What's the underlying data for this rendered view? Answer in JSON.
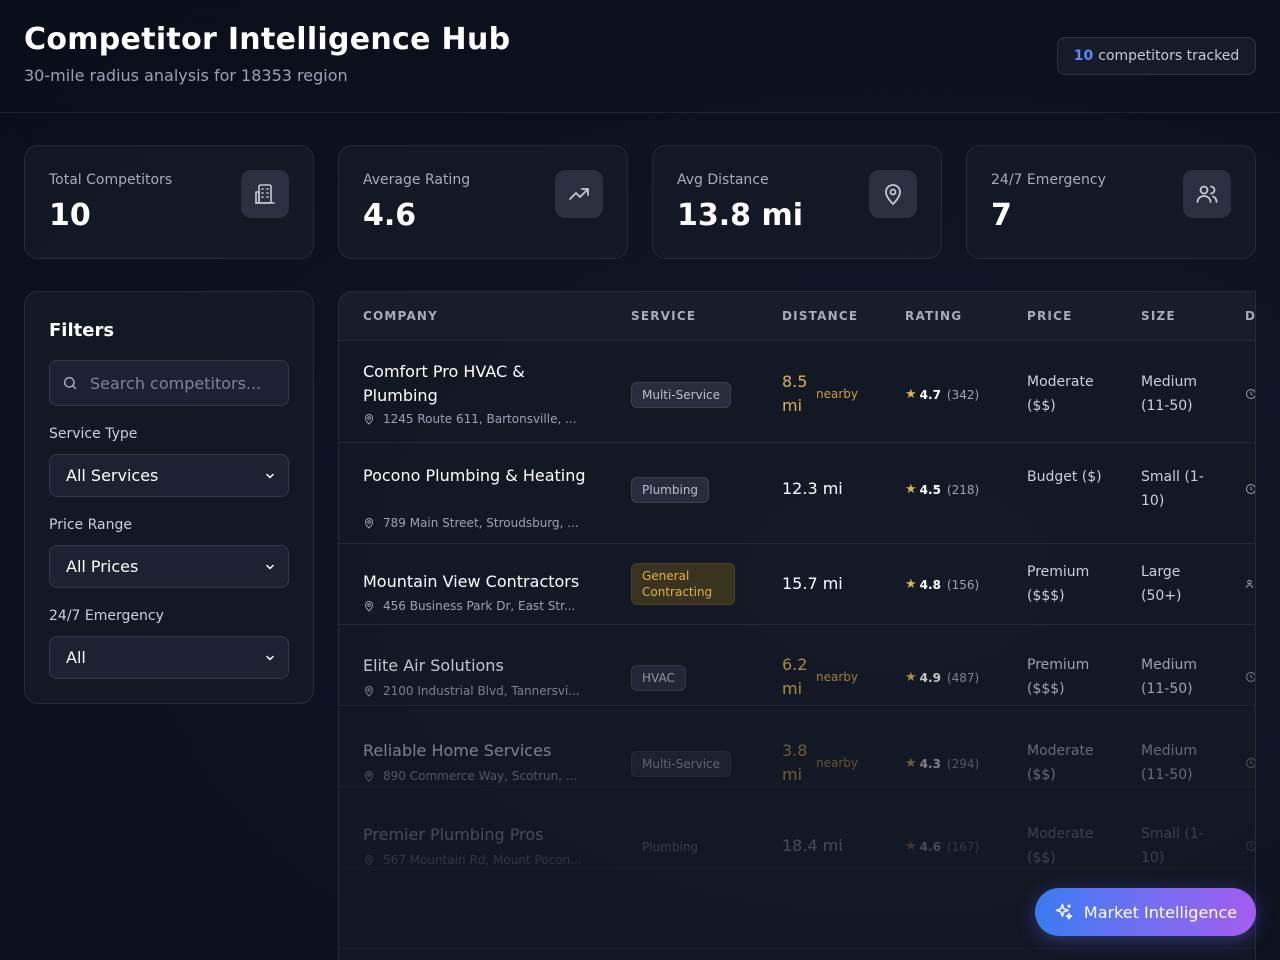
{
  "header": {
    "title": "Competitor Intelligence Hub",
    "subtitle": "30-mile radius analysis for 18353 region",
    "tracked_count": "10",
    "tracked_label": "competitors tracked"
  },
  "stats": [
    {
      "label": "Total Competitors",
      "value": "10",
      "icon": "building-icon"
    },
    {
      "label": "Average Rating",
      "value": "4.6",
      "icon": "trending-up-icon"
    },
    {
      "label": "Avg Distance",
      "value": "13.8 mi",
      "icon": "map-pin-icon"
    },
    {
      "label": "24/7 Emergency",
      "value": "7",
      "icon": "users-icon"
    }
  ],
  "filters": {
    "title": "Filters",
    "search_placeholder": "Search competitors...",
    "service_label": "Service Type",
    "service_value": "All Services",
    "price_label": "Price Range",
    "price_value": "All Prices",
    "emergency_label": "24/7 Emergency",
    "emergency_value": "All"
  },
  "table": {
    "columns": [
      "COMPANY",
      "SERVICE",
      "DISTANCE",
      "RATING",
      "PRICE",
      "SIZE",
      "D"
    ],
    "rows": [
      {
        "name": "Comfort Pro HVAC & Plumbing",
        "address": "1245 Route 611, Bartonsville, ...",
        "service": "Multi-Service",
        "distance": "8.5 mi",
        "nearby": "nearby",
        "rating": "4.7",
        "reviews": "(342)",
        "price": "Moderate ($$)",
        "size": "Medium (11-50)"
      },
      {
        "name": "Pocono Plumbing & Heating",
        "address": "789 Main Street, Stroudsburg, ...",
        "service": "Plumbing",
        "distance": "12.3 mi",
        "nearby": "",
        "rating": "4.5",
        "reviews": "(218)",
        "price": "Budget ($)",
        "size": "Small (1-10)"
      },
      {
        "name": "Mountain View Contractors",
        "address": "456 Business Park Dr, East Str...",
        "service": "General Contracting",
        "distance": "15.7 mi",
        "nearby": "",
        "rating": "4.8",
        "reviews": "(156)",
        "price": "Premium ($$$)",
        "size": "Large (50+)"
      },
      {
        "name": "Elite Air Solutions",
        "address": "2100 Industrial Blvd, Tannersvi...",
        "service": "HVAC",
        "distance": "6.2 mi",
        "nearby": "nearby",
        "rating": "4.9",
        "reviews": "(487)",
        "price": "Premium ($$$)",
        "size": "Medium (11-50)"
      },
      {
        "name": "Reliable Home Services",
        "address": "890 Commerce Way, Scotrun, ...",
        "service": "Multi-Service",
        "distance": "3.8 mi",
        "nearby": "nearby",
        "rating": "4.3",
        "reviews": "(294)",
        "price": "Moderate ($$)",
        "size": "Medium (11-50)"
      },
      {
        "name": "Premier Plumbing Pros",
        "address": "567 Mountain Rd, Mount Pocon...",
        "service": "Plumbing",
        "distance": "18.4 mi",
        "nearby": "",
        "rating": "4.6",
        "reviews": "(167)",
        "price": "Moderate ($$)",
        "size": "Small (1-10)"
      }
    ]
  },
  "fab": {
    "label": "Market Intelligence"
  },
  "colors": {
    "accent": "#5b8cf5",
    "star": "#e0b14a",
    "nearby": "#e0b14a"
  }
}
